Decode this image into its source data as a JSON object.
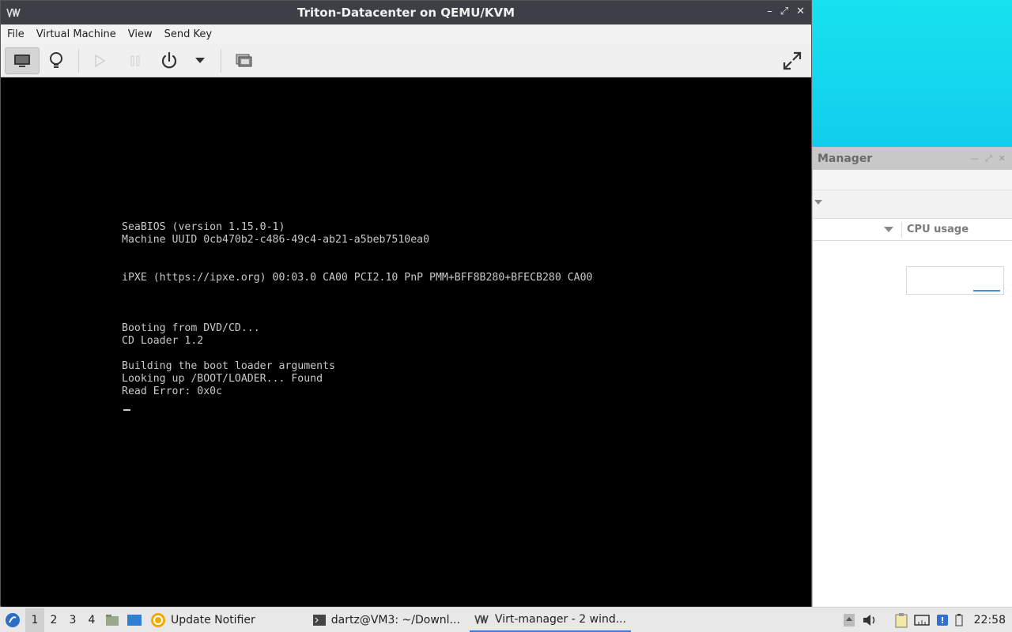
{
  "vm_window": {
    "title": "Triton-Datacenter on QEMU/KVM",
    "menu": [
      "File",
      "Virtual Machine",
      "View",
      "Send Key"
    ]
  },
  "console_lines": [
    "SeaBIOS (version 1.15.0-1)",
    "Machine UUID 0cb470b2-c486-49c4-ab21-a5beb7510ea0",
    "",
    "",
    "iPXE (https://ipxe.org) 00:03.0 CA00 PCI2.10 PnP PMM+BFF8B280+BFECB280 CA00",
    "",
    "",
    "",
    "Booting from DVD/CD...",
    "CD Loader 1.2",
    "",
    "Building the boot loader arguments",
    "Looking up /BOOT/LOADER... Found",
    "Read Error: 0x0c"
  ],
  "manager_window": {
    "title": "Manager",
    "column_header": "CPU usage"
  },
  "taskbar": {
    "workspaces": [
      "1",
      "2",
      "3",
      "4"
    ],
    "tasks": [
      "Update Notifier",
      "dartz@VM3: ~/Downl...",
      "Virt-manager - 2 wind..."
    ],
    "clock": "22:58"
  },
  "colors": {
    "titlebar": "#3c3f45",
    "console_text": "#c8c8c8",
    "active_task_underline": "#3c7dd9"
  }
}
